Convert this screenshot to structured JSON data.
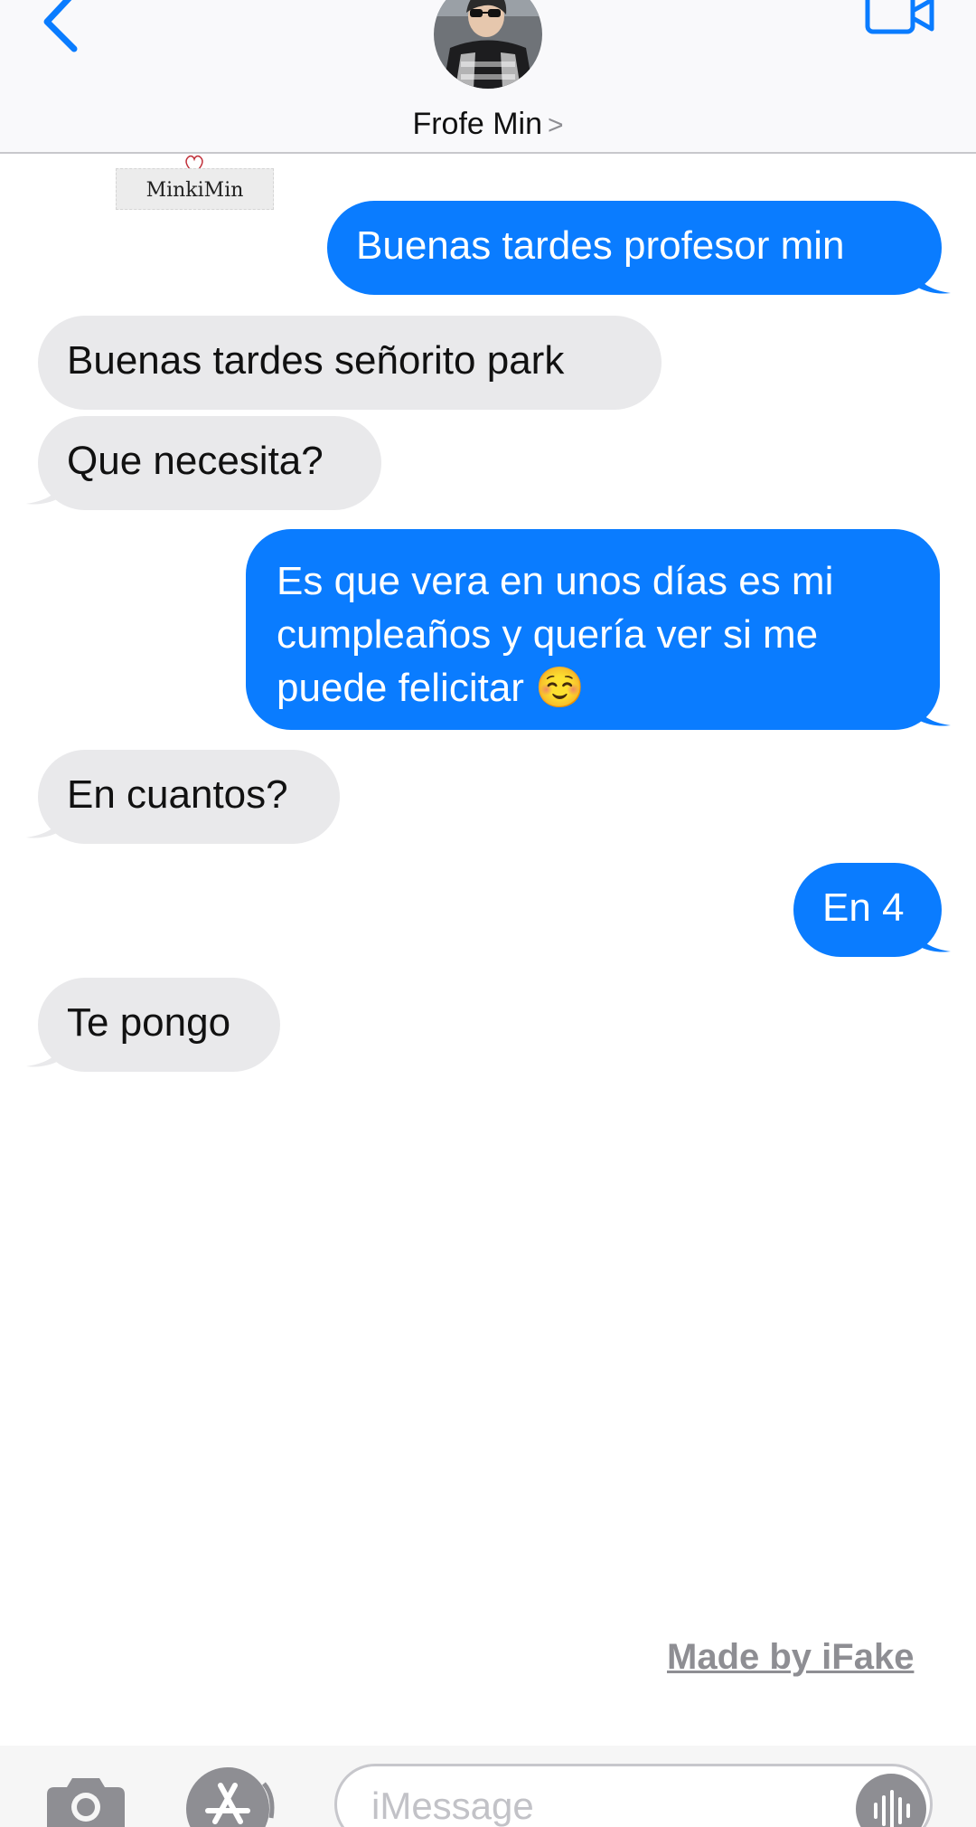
{
  "header": {
    "contact_name": "Frofe Min",
    "chevron": ">"
  },
  "watermark": {
    "text": "MinkiMin"
  },
  "messages": [
    {
      "from": "me",
      "text": "Buenas tardes profesor min"
    },
    {
      "from": "them",
      "text": "Buenas tardes señorito park"
    },
    {
      "from": "them",
      "text": "Que necesita?"
    },
    {
      "from": "me",
      "text": "Es que vera en unos días es mi cumpleaños y quería ver si me puede felicitar ☺️"
    },
    {
      "from": "them",
      "text": "En cuantos?"
    },
    {
      "from": "me",
      "text": "En 4"
    },
    {
      "from": "them",
      "text": "Te pongo"
    }
  ],
  "footer": {
    "made_by": "Made by iFake"
  },
  "input": {
    "placeholder": "iMessage"
  },
  "colors": {
    "accent": "#0a7cff",
    "incoming_bubble": "#e9e9eb",
    "background": "#ffffff"
  },
  "icons": [
    "back-chevron-icon",
    "video-call-icon",
    "camera-icon",
    "app-store-icon",
    "audio-waveform-icon"
  ]
}
